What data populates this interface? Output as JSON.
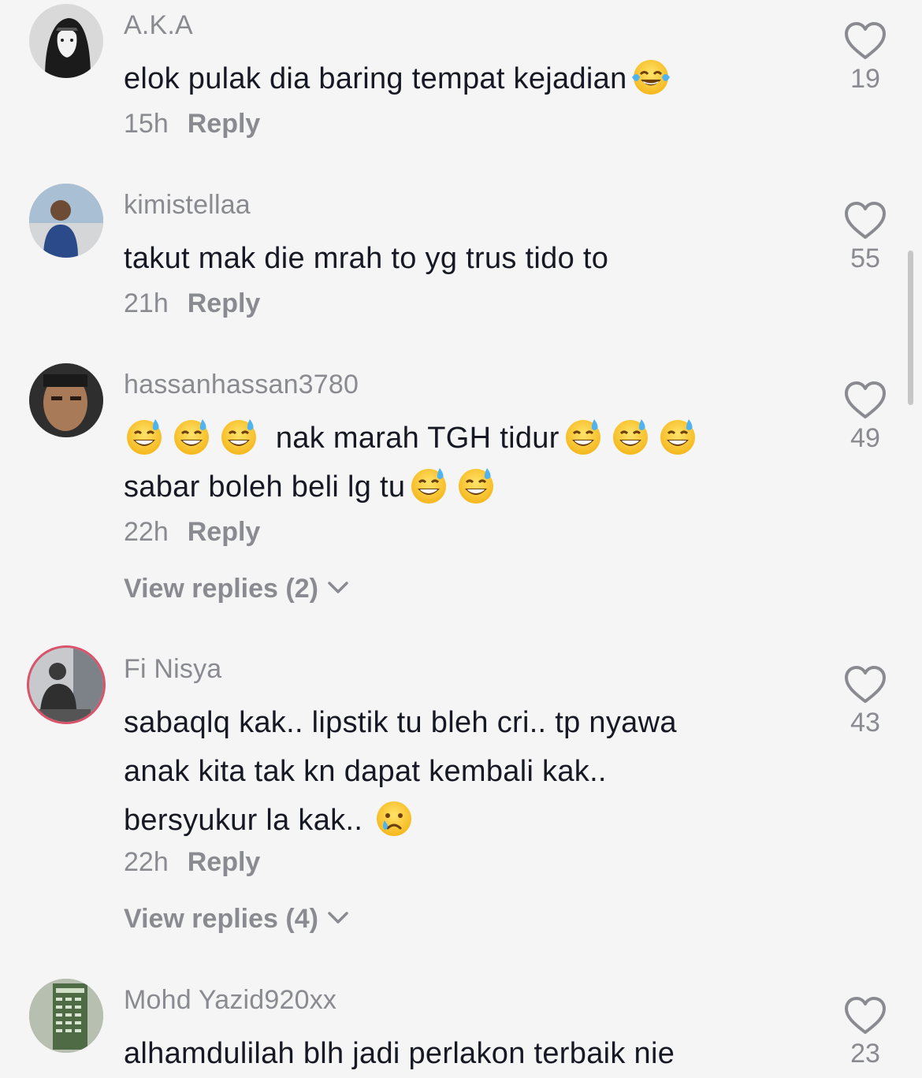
{
  "comments": [
    {
      "username": "A.K.A",
      "lines": [
        "elok pulak dia baring tempat kejadian"
      ],
      "emoji": [
        "😂"
      ],
      "time": "15h",
      "reply": "Reply",
      "likes": "19",
      "avatar": "avatar-dark-illustration"
    },
    {
      "username": "kimistellaa",
      "lines": [
        "takut mak die mrah to yg trus tido to"
      ],
      "time": "21h",
      "reply": "Reply",
      "likes": "55",
      "avatar": "avatar-person-car"
    },
    {
      "username": "hassanhassan3780",
      "lines": [
        "nak marah TGH tidur",
        "sabar boleh beli lg tu"
      ],
      "emoji": [
        "😅"
      ],
      "time": "22h",
      "reply": "Reply",
      "likes": "49",
      "view_replies": "View replies (2)",
      "avatar": "avatar-selfie"
    },
    {
      "username": "Fi Nisya",
      "lines": [
        "sabaqlq kak.. lipstik tu bleh cri.. tp nyawa",
        "anak kita tak kn dapat kembali kak..",
        "bersyukur la kak.."
      ],
      "emoji": [
        "😢"
      ],
      "time": "22h",
      "reply": "Reply",
      "likes": "43",
      "view_replies": "View replies (4)",
      "avatar": "avatar-person-sitting"
    },
    {
      "username": "Mohd Yazid920xx",
      "lines": [
        "alhamdulilah blh jadi perlakon terbaik nie"
      ],
      "likes": "23",
      "avatar": "avatar-building-sign"
    }
  ],
  "icons": {
    "like": "heart-outline-icon",
    "expand": "chevron-down-icon"
  },
  "colors": {
    "background": "#f5f5f5",
    "secondary_text": "#8a8b91",
    "primary_text": "#161823"
  }
}
